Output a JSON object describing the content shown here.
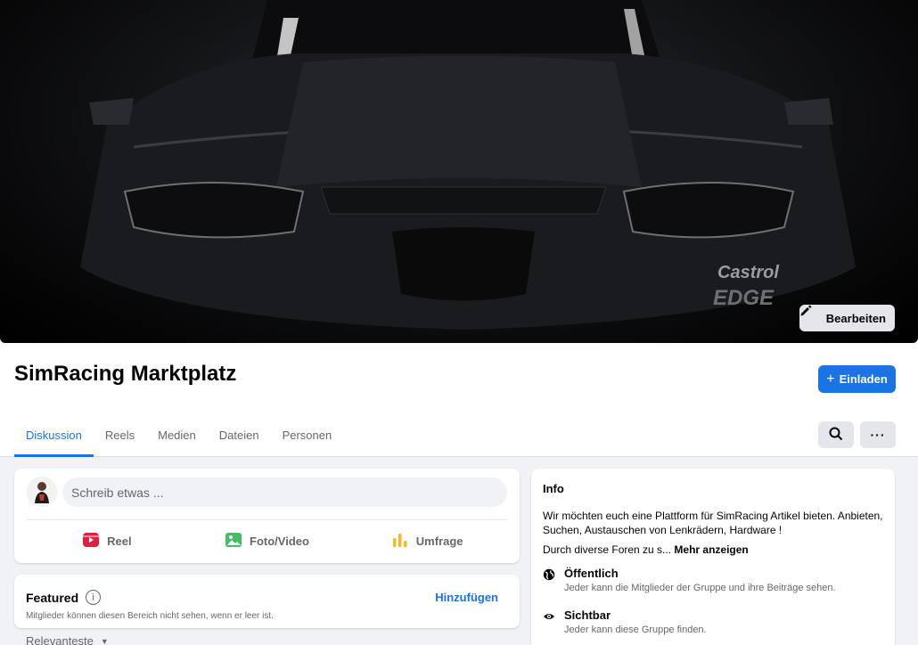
{
  "cover": {
    "edit_label": "Bearbeiten"
  },
  "group": {
    "title": "SimRacing Marktplatz",
    "invite_label": "Einladen"
  },
  "tabs": [
    {
      "label": "Diskussion"
    },
    {
      "label": "Reels"
    },
    {
      "label": "Medien"
    },
    {
      "label": "Dateien"
    },
    {
      "label": "Personen"
    }
  ],
  "composer": {
    "placeholder": "Schreib etwas ...",
    "actions": [
      {
        "label": "Reel",
        "icon": "reel-icon",
        "color": "#e41e3f"
      },
      {
        "label": "Foto/Video",
        "icon": "photo-icon",
        "color": "#45bd62"
      },
      {
        "label": "Umfrage",
        "icon": "poll-icon",
        "color": "#f7b928"
      }
    ]
  },
  "featured": {
    "title": "Featured",
    "add_label": "Hinzufügen",
    "note": "Mitglieder können diesen Bereich nicht sehen, wenn er leer ist."
  },
  "sort": {
    "label": "Relevanteste"
  },
  "info": {
    "title": "Info",
    "description": "Wir möchten euch eine Plattform für SimRacing Artikel bieten. Anbieten, Suchen, Austauschen von Lenkrädern, Hardware !",
    "truncated": "Durch diverse Foren zu s...",
    "more_label": "Mehr anzeigen",
    "rows": [
      {
        "title": "Öffentlich",
        "sub": "Jeder kann die Mitglieder der Gruppe und ihre Beiträge sehen."
      },
      {
        "title": "Sichtbar",
        "sub": "Jeder kann diese Gruppe finden."
      }
    ]
  },
  "colors": {
    "accent": "#1b74e4"
  }
}
